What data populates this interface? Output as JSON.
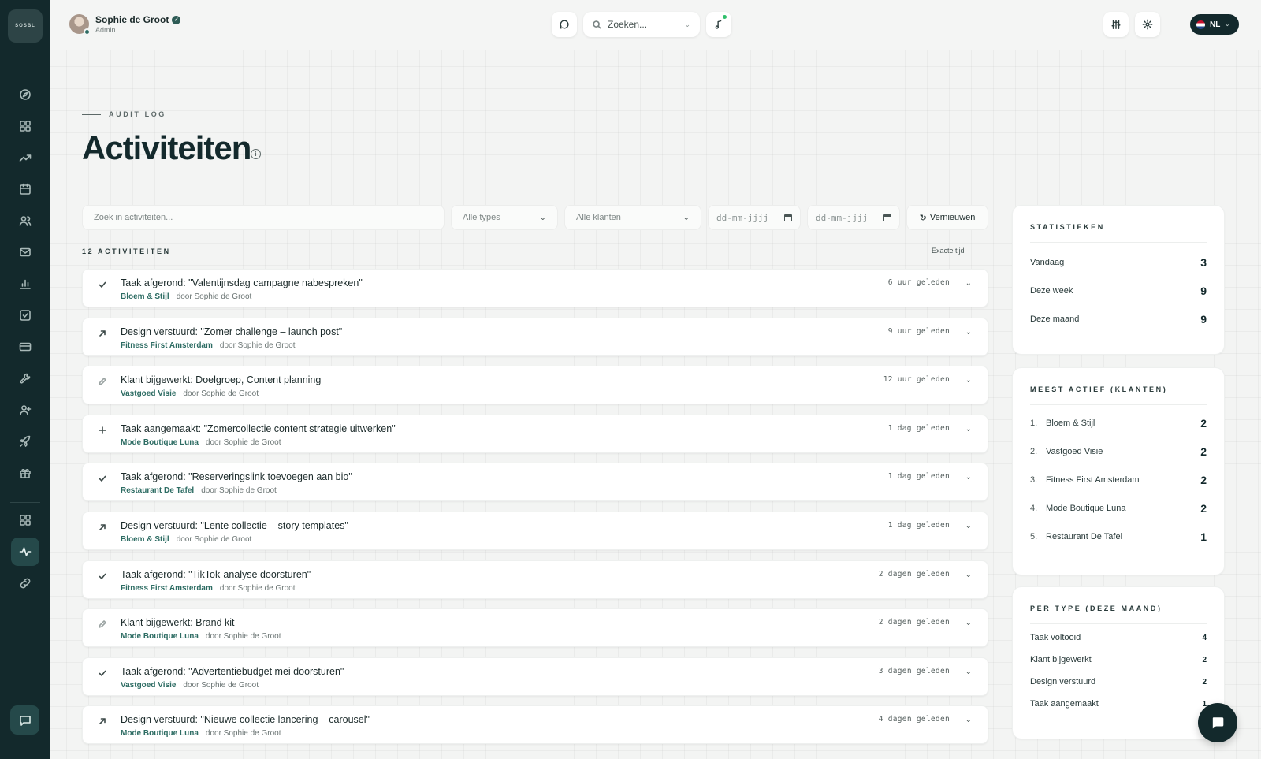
{
  "logo": {
    "text": "SOSBL"
  },
  "user": {
    "name": "Sophie de Groot",
    "role": "Admin"
  },
  "search": {
    "placeholder": "Zoeken..."
  },
  "language": {
    "code": "NL"
  },
  "sidebar": {
    "items": [
      {
        "name": "compass"
      },
      {
        "name": "dashboard"
      },
      {
        "name": "trending"
      },
      {
        "name": "calendar"
      },
      {
        "name": "users"
      },
      {
        "name": "mail"
      },
      {
        "name": "bar-chart"
      },
      {
        "name": "check-square"
      },
      {
        "name": "credit-card"
      },
      {
        "name": "tool"
      },
      {
        "name": "user-plus"
      },
      {
        "name": "rocket"
      },
      {
        "name": "gift"
      },
      {
        "name": "grid"
      },
      {
        "name": "activity",
        "active": true
      },
      {
        "name": "link"
      }
    ]
  },
  "header": {
    "eyebrow": "AUDIT LOG",
    "title": "Activiteiten"
  },
  "filters": {
    "search_placeholder": "Zoek in activiteiten...",
    "type_select": "Alle types",
    "client_select": "Alle klanten",
    "date_from": "dd-mm-jjjj",
    "date_to": "dd-mm-jjjj",
    "refresh_label": "Vernieuwen"
  },
  "list": {
    "count_label": "12 ACTIVITEITEN",
    "exact_time_label": "Exacte tijd",
    "items": [
      {
        "icon": "check",
        "title": "Taak afgerond: \"Valentijnsdag campagne nabespreken\"",
        "client": "Bloem & Stijl",
        "by": "door Sophie de Groot",
        "time": "6 uur geleden"
      },
      {
        "icon": "arrow",
        "title": "Design verstuurd: \"Zomer challenge – launch post\"",
        "client": "Fitness First Amsterdam",
        "by": "door Sophie de Groot",
        "time": "9 uur geleden"
      },
      {
        "icon": "pencil",
        "title": "Klant bijgewerkt: Doelgroep, Content planning",
        "client": "Vastgoed Visie",
        "by": "door Sophie de Groot",
        "time": "12 uur geleden"
      },
      {
        "icon": "plus",
        "title": "Taak aangemaakt: \"Zomercollectie content strategie uitwerken\"",
        "client": "Mode Boutique Luna",
        "by": "door Sophie de Groot",
        "time": "1 dag geleden"
      },
      {
        "icon": "check",
        "title": "Taak afgerond: \"Reserveringslink toevoegen aan bio\"",
        "client": "Restaurant De Tafel",
        "by": "door Sophie de Groot",
        "time": "1 dag geleden"
      },
      {
        "icon": "arrow",
        "title": "Design verstuurd: \"Lente collectie – story templates\"",
        "client": "Bloem & Stijl",
        "by": "door Sophie de Groot",
        "time": "1 dag geleden"
      },
      {
        "icon": "check",
        "title": "Taak afgerond: \"TikTok-analyse doorsturen\"",
        "client": "Fitness First Amsterdam",
        "by": "door Sophie de Groot",
        "time": "2 dagen geleden"
      },
      {
        "icon": "pencil",
        "title": "Klant bijgewerkt: Brand kit",
        "client": "Mode Boutique Luna",
        "by": "door Sophie de Groot",
        "time": "2 dagen geleden"
      },
      {
        "icon": "check",
        "title": "Taak afgerond: \"Advertentiebudget mei doorsturen\"",
        "client": "Vastgoed Visie",
        "by": "door Sophie de Groot",
        "time": "3 dagen geleden"
      },
      {
        "icon": "arrow",
        "title": "Design verstuurd: \"Nieuwe collectie lancering – carousel\"",
        "client": "Mode Boutique Luna",
        "by": "door Sophie de Groot",
        "time": "4 dagen geleden"
      }
    ]
  },
  "stats": {
    "title": "STATISTIEKEN",
    "rows": [
      {
        "label": "Vandaag",
        "value": "3"
      },
      {
        "label": "Deze week",
        "value": "9"
      },
      {
        "label": "Deze maand",
        "value": "9"
      }
    ]
  },
  "most_active": {
    "title": "MEEST ACTIEF (KLANTEN)",
    "rows": [
      {
        "rank": "1.",
        "label": "Bloem & Stijl",
        "value": "2"
      },
      {
        "rank": "2.",
        "label": "Vastgoed Visie",
        "value": "2"
      },
      {
        "rank": "3.",
        "label": "Fitness First Amsterdam",
        "value": "2"
      },
      {
        "rank": "4.",
        "label": "Mode Boutique Luna",
        "value": "2"
      },
      {
        "rank": "5.",
        "label": "Restaurant De Tafel",
        "value": "1"
      }
    ]
  },
  "per_type": {
    "title": "PER TYPE (DEZE MAAND)",
    "rows": [
      {
        "label": "Taak voltooid",
        "value": "4"
      },
      {
        "label": "Klant bijgewerkt",
        "value": "2"
      },
      {
        "label": "Design verstuurd",
        "value": "2"
      },
      {
        "label": "Taak aangemaakt",
        "value": "1"
      }
    ]
  }
}
